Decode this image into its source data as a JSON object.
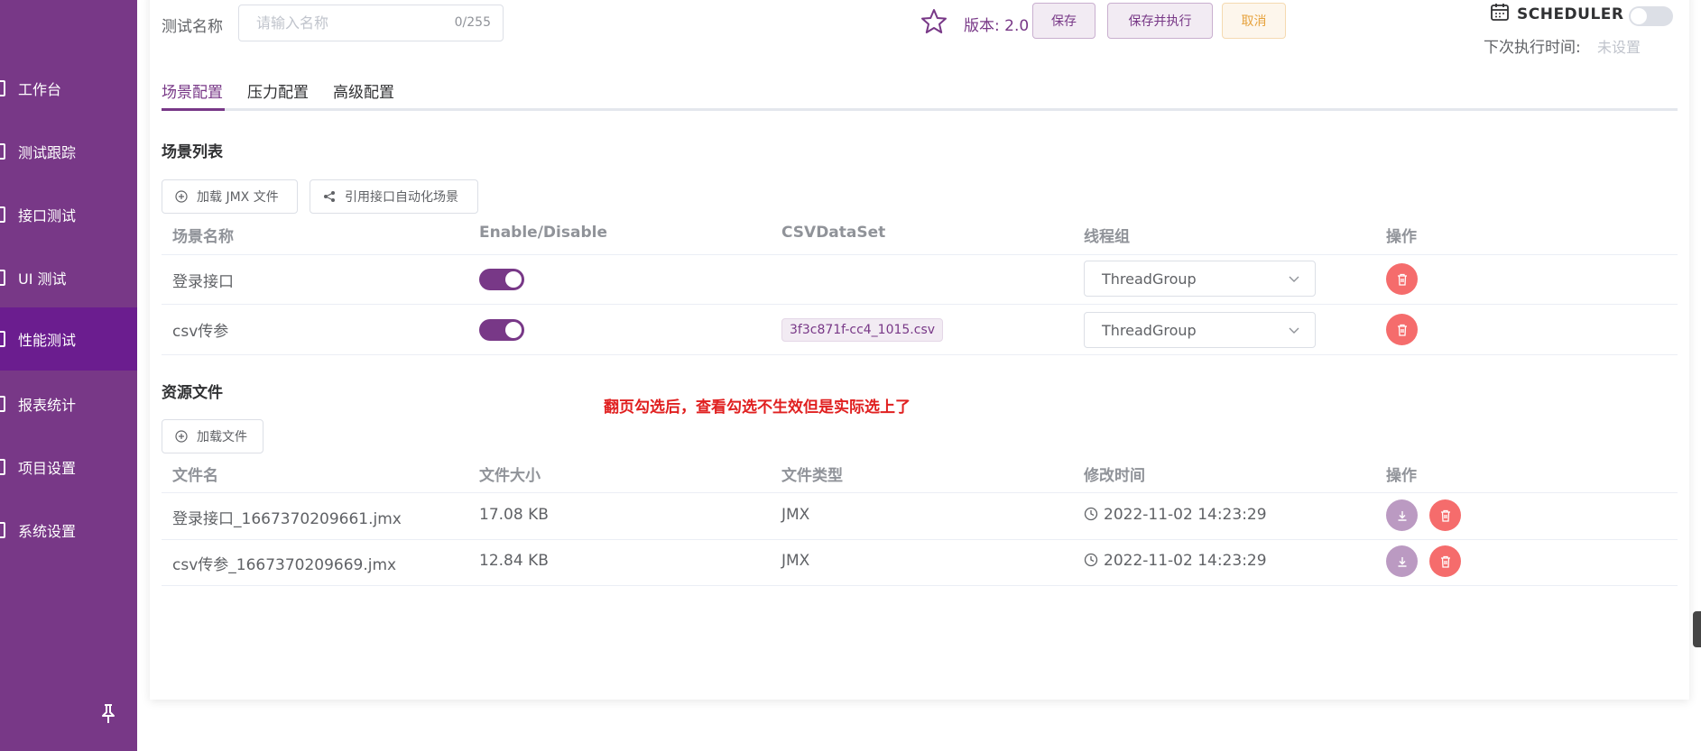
{
  "sidebar": {
    "items": [
      {
        "label": "工作台",
        "icon": "monitor-icon",
        "active": false
      },
      {
        "label": "测试跟踪",
        "icon": "track-icon",
        "active": false
      },
      {
        "label": "接口测试",
        "icon": "api-icon",
        "active": false
      },
      {
        "label": "UI 测试",
        "icon": "ui-icon",
        "active": false
      },
      {
        "label": "性能测试",
        "icon": "performance-icon",
        "active": true
      },
      {
        "label": "报表统计",
        "icon": "report-icon",
        "active": false
      },
      {
        "label": "项目设置",
        "icon": "project-icon",
        "active": false
      },
      {
        "label": "系统设置",
        "icon": "settings-icon",
        "active": false
      }
    ],
    "pin_icon": "pin-icon"
  },
  "header": {
    "name_label": "测试名称",
    "name_placeholder": "请输入名称",
    "name_value": "",
    "name_count": "0/255",
    "star_icon": "star-icon",
    "version": "版本: 2.0",
    "save_label": "保存",
    "save_execute_label": "保存并执行",
    "cancel_label": "取消",
    "scheduler_icon": "calendar-icon",
    "scheduler_label": "SCHEDULER",
    "next_exec_label": "下次执行时间:",
    "next_exec_value": "未设置"
  },
  "tabs": [
    {
      "label": "场景配置",
      "active": true
    },
    {
      "label": "压力配置",
      "active": false
    },
    {
      "label": "高级配置",
      "active": false
    }
  ],
  "scenes": {
    "title": "场景列表",
    "load_jmx_label": "加载 JMX 文件",
    "reference_label": "引用接口自动化场景",
    "columns": [
      "场景名称",
      "Enable/Disable",
      "CSVDataSet",
      "线程组",
      "操作"
    ],
    "rows": [
      {
        "name": "登录接口",
        "enabled": true,
        "csv": "",
        "thread_group": "ThreadGroup"
      },
      {
        "name": "csv传参",
        "enabled": true,
        "csv": "3f3c871f-cc4_1015.csv",
        "thread_group": "ThreadGroup"
      }
    ]
  },
  "resources": {
    "title": "资源文件",
    "load_file_label": "加载文件",
    "columns": [
      "文件名",
      "文件大小",
      "文件类型",
      "修改时间",
      "操作"
    ],
    "rows": [
      {
        "name": "登录接口_1667370209661.jmx",
        "size": "17.08 KB",
        "type": "JMX",
        "modified": "2022-11-02 14:23:29"
      },
      {
        "name": "csv传参_1667370209669.jmx",
        "size": "12.84 KB",
        "type": "JMX",
        "modified": "2022-11-02 14:23:29"
      }
    ]
  },
  "annotation": "翻页勾选后，查看勾选不生效但是实际选上了",
  "colors": {
    "primary": "#783887",
    "sidebar_active": "#6b1d8f",
    "danger": "#f56c6c",
    "warning": "#e6a23c",
    "annotation": "#e02020"
  }
}
